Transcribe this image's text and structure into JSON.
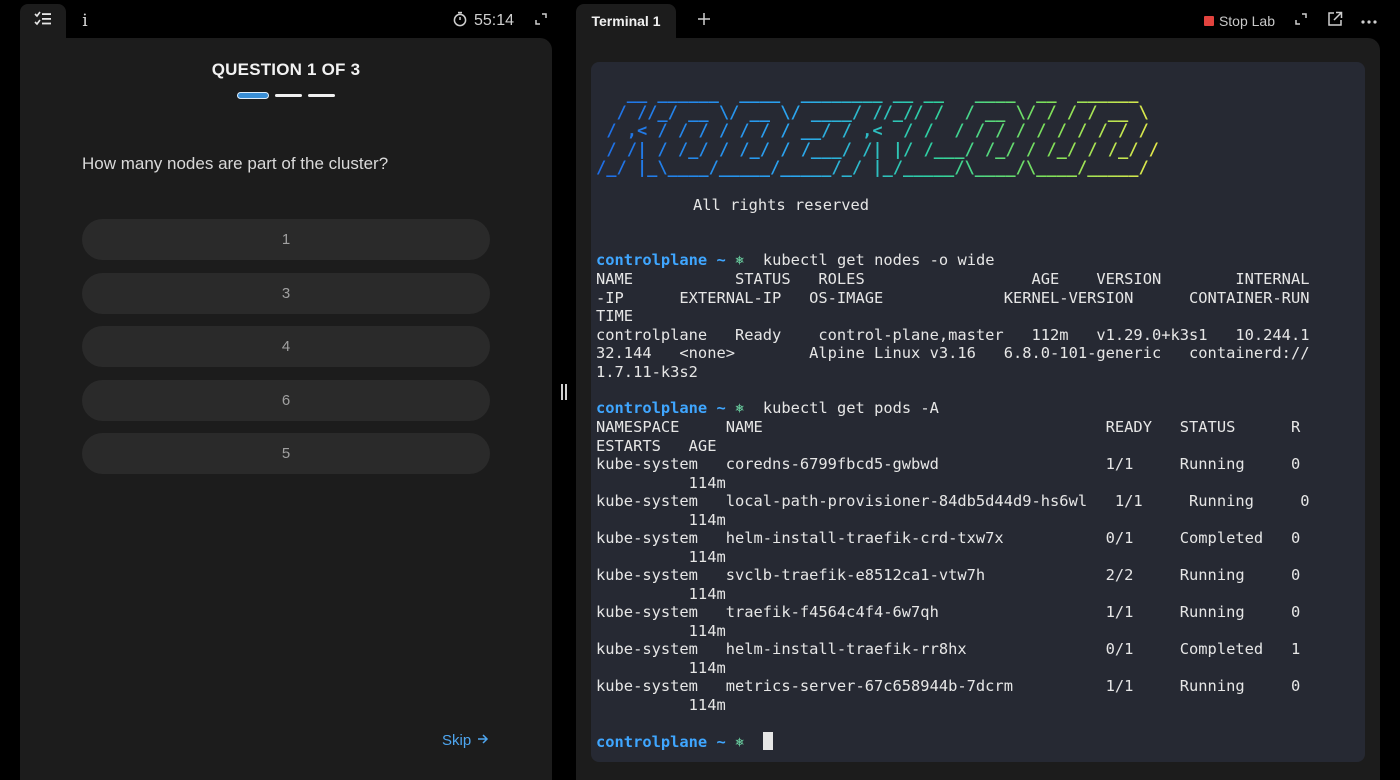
{
  "quiz": {
    "timer": "55:14",
    "title": "QUESTION 1 OF 3",
    "question": "How many nodes are part of the cluster?",
    "options": [
      "1",
      "3",
      "4",
      "6",
      "5"
    ],
    "skip_label": "Skip",
    "progress_current": 1,
    "progress_total": 3
  },
  "terminal": {
    "tab_label": "Terminal 1",
    "stop_label": "Stop Lab",
    "logo_lines": [
      "   __ ______  ____  ________ __ __   ____  __  ______",
      "  / //_/ __ \\/ __ \\/ ____/ //_// /  / __ \\/ / / / __ \\",
      " / ,< / / / / / / / __/ / ,<  / /  / / / / / / / / / /",
      " / /| / /_/ / /_/ / /___/ /| |/ /___/ /_/ / /_/ / /_/ /",
      "/_/ |_\\____/_____/_____/_/ |_/_____/\\____/\\____/_____/"
    ],
    "rights": "All rights reserved",
    "prompt_host": "controlplane",
    "prompt_dir": "~",
    "cmd1": "kubectl get nodes -o wide",
    "nodes_output": [
      "NAME           STATUS   ROLES                  AGE    VERSION        INTERNAL",
      "-IP      EXTERNAL-IP   OS-IMAGE             KERNEL-VERSION      CONTAINER-RUN",
      "TIME",
      "controlplane   Ready    control-plane,master   112m   v1.29.0+k3s1   10.244.1",
      "32.144   <none>        Alpine Linux v3.16   6.8.0-101-generic   containerd://",
      "1.7.11-k3s2"
    ],
    "cmd2": "kubectl get pods -A",
    "pods_output": [
      "NAMESPACE     NAME                                     READY   STATUS      R",
      "ESTARTS   AGE",
      "kube-system   coredns-6799fbcd5-gwbwd                  1/1     Running     0",
      "          114m",
      "kube-system   local-path-provisioner-84db5d44d9-hs6wl   1/1     Running     0",
      "          114m",
      "kube-system   helm-install-traefik-crd-txw7x           0/1     Completed   0",
      "          114m",
      "kube-system   svclb-traefik-e8512ca1-vtw7h             2/2     Running     0",
      "          114m",
      "kube-system   traefik-f4564c4f4-6w7qh                  1/1     Running     0",
      "          114m",
      "kube-system   helm-install-traefik-rr8hx               0/1     Completed   1",
      "          114m",
      "kube-system   metrics-server-67c658944b-7dcrm          1/1     Running     0",
      "          114m"
    ]
  },
  "icons": {
    "quiz_tab": "checklist-icon",
    "info": "info-icon",
    "timer": "stopwatch-icon",
    "expand": "expand-icon",
    "add_tab": "plus-icon",
    "stop": "stop-icon",
    "external": "external-link-icon",
    "more": "more-icon",
    "prompt": "kubernetes-icon"
  },
  "colors": {
    "accent": "#3a8fd6",
    "link": "#4ea6f0",
    "prompt": "#3fa6ff",
    "stop": "#e2433e",
    "panel": "#1c1c1c",
    "terminal_bg": "#262933"
  }
}
